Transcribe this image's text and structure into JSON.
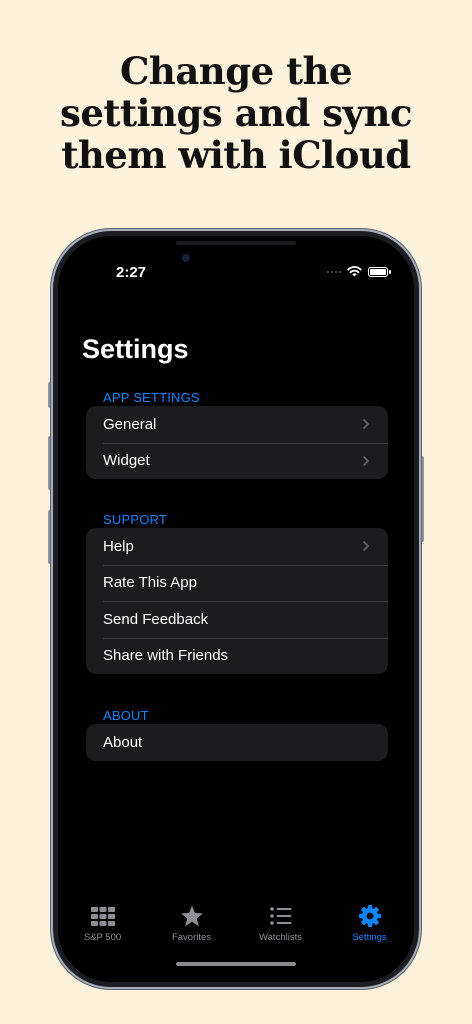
{
  "headline": [
    "Change the",
    "settings and sync",
    "them with iCloud"
  ],
  "status_bar": {
    "time": "2:27"
  },
  "page_title": "Settings",
  "sections": [
    {
      "header": "APP SETTINGS",
      "rows": [
        {
          "label": "General",
          "chevron": true
        },
        {
          "label": "Widget",
          "chevron": true
        }
      ]
    },
    {
      "header": "SUPPORT",
      "rows": [
        {
          "label": "Help",
          "chevron": true
        },
        {
          "label": "Rate This App",
          "chevron": false
        },
        {
          "label": "Send Feedback",
          "chevron": false
        },
        {
          "label": "Share with Friends",
          "chevron": false
        }
      ]
    },
    {
      "header": "ABOUT",
      "rows": [
        {
          "label": "About",
          "chevron": false
        }
      ]
    }
  ],
  "tab_bar": {
    "tabs": [
      {
        "label": "S&P 500",
        "icon": "grid-icon",
        "active": false
      },
      {
        "label": "Favorites",
        "icon": "star-icon",
        "active": false
      },
      {
        "label": "Watchlists",
        "icon": "list-icon",
        "active": false
      },
      {
        "label": "Settings",
        "icon": "gear-icon",
        "active": true
      }
    ]
  },
  "colors": {
    "accent": "#0a84ff",
    "background": "#fdf3dd",
    "screen": "#000000",
    "cell": "#1c1c1e"
  }
}
